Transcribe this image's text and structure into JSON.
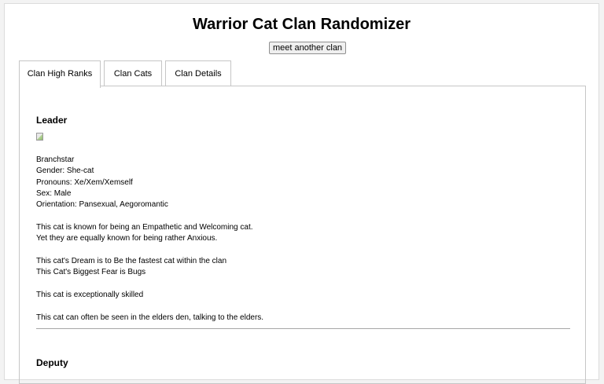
{
  "header": {
    "title": "Warrior Cat Clan Randomizer"
  },
  "actions": {
    "meet_button": "meet another clan"
  },
  "tabs": [
    {
      "label": "Clan High Ranks",
      "active": true
    },
    {
      "label": "Clan Cats",
      "active": false
    },
    {
      "label": "Clan Details",
      "active": false
    }
  ],
  "leader": {
    "heading": "Leader",
    "image_icon": "broken-image-icon",
    "name": "Branchstar",
    "gender": "Gender: She-cat",
    "pronouns": "Pronouns: Xe/Xem/Xemself",
    "sex": "Sex: Male",
    "orientation": "Orientation: Pansexual, Aegoromantic",
    "traits_line1": "This cat is known for being an Empathetic and Welcoming cat.",
    "traits_line2": "Yet they are equally known for being rather Anxious.",
    "dream": "This cat's Dream is to Be the fastest cat within the clan",
    "fear": "This Cat's Biggest Fear is Bugs",
    "skill": "This cat is exceptionally skilled",
    "habit": "This cat can often be seen in the elders den, talking to the elders."
  },
  "deputy": {
    "heading": "Deputy"
  }
}
